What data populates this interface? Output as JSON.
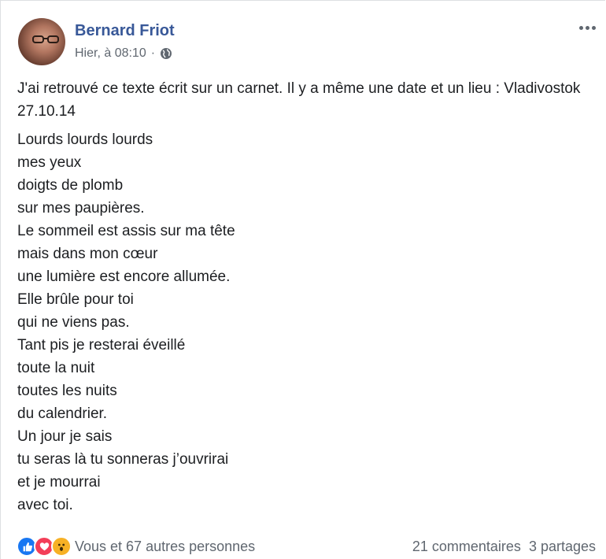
{
  "post": {
    "author": "Bernard Friot",
    "timestamp": "Hier, à 08:10",
    "separator": "·",
    "privacy_icon": "globe-icon",
    "menu_icon": "more-options-icon",
    "intro": "J'ai retrouvé ce texte écrit sur un carnet. Il y a même une date et un lieu : Vladivostok 27.10.14",
    "poem_lines": [
      "Lourds lourds lourds",
      "mes yeux",
      "doigts de plomb",
      "sur mes paupières.",
      "Le sommeil est assis sur ma tête",
      "mais dans mon cœur",
      "une lumière est encore allumée.",
      "Elle brûle pour toi",
      "qui ne viens pas.",
      "Tant pis je resterai éveillé",
      "toute la nuit",
      "toutes les nuits",
      "du calendrier.",
      "Un jour je sais",
      "tu seras là tu sonneras j’ouvrirai",
      "et je mourrai",
      "avec toi."
    ]
  },
  "footer": {
    "reaction_icons": [
      "like-icon",
      "love-icon",
      "wow-icon"
    ],
    "reactions_text": "Vous et 67 autres personnes",
    "comments_text": "21 commentaires",
    "shares_text": "3 partages"
  },
  "colors": {
    "author": "#385898",
    "meta": "#606770",
    "like": "#1877f2",
    "love": "#f33e58",
    "wow": "#f7b125"
  }
}
